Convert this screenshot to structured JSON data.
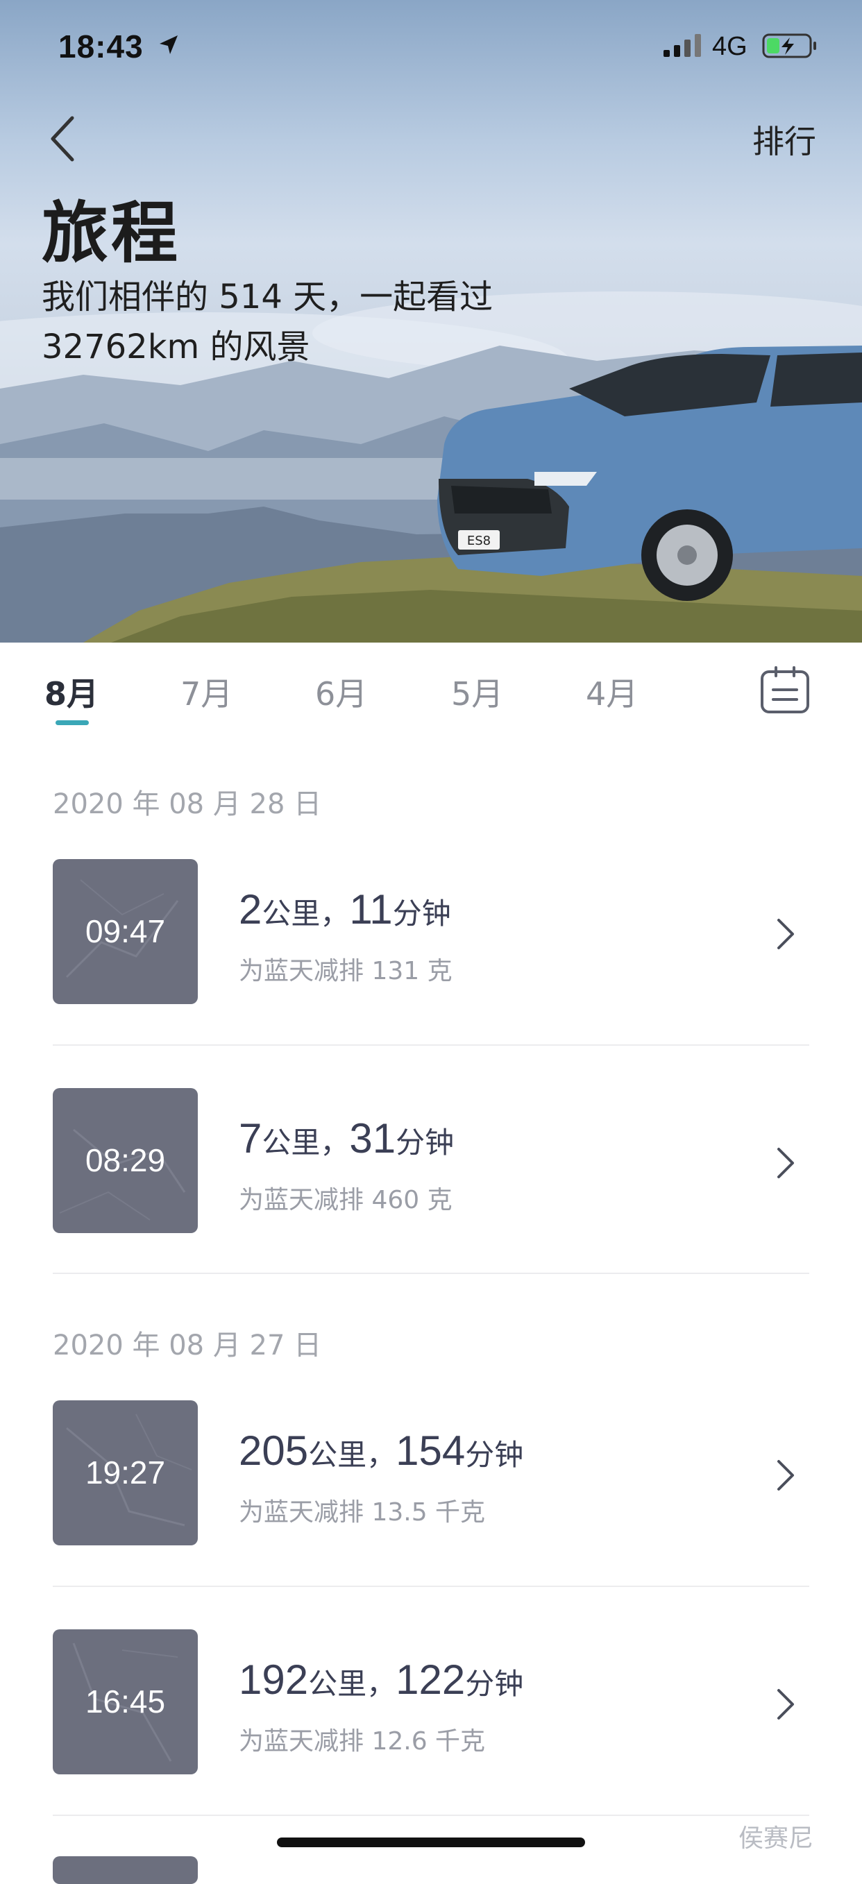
{
  "status": {
    "time": "18:43",
    "network": "4G"
  },
  "header": {
    "rank_label": "排行",
    "title": "旅程",
    "subtitle_line1": "我们相伴的 514 天，一起看过",
    "subtitle_line2": "32762km 的风景"
  },
  "tabs": [
    {
      "label": "8月",
      "active": true
    },
    {
      "label": "7月",
      "active": false
    },
    {
      "label": "6月",
      "active": false
    },
    {
      "label": "5月",
      "active": false
    },
    {
      "label": "4月",
      "active": false
    }
  ],
  "days": [
    {
      "date": "2020 年 08 月 28 日",
      "trips": [
        {
          "time": "09:47",
          "distance": "2",
          "distance_unit": "公里，",
          "duration": "11",
          "duration_unit": "分钟",
          "emission": "为蓝天减排 131 克"
        },
        {
          "time": "08:29",
          "distance": "7",
          "distance_unit": "公里，",
          "duration": "31",
          "duration_unit": "分钟",
          "emission": "为蓝天减排 460 克"
        }
      ]
    },
    {
      "date": "2020 年 08 月 27 日",
      "trips": [
        {
          "time": "19:27",
          "distance": "205",
          "distance_unit": "公里，",
          "duration": "154",
          "duration_unit": "分钟",
          "emission": "为蓝天减排 13.5 千克"
        },
        {
          "time": "16:45",
          "distance": "192",
          "distance_unit": "公里，",
          "duration": "122",
          "duration_unit": "分钟",
          "emission": "为蓝天减排 12.6 千克"
        }
      ]
    }
  ],
  "car_badge": "ES8",
  "watermark": "侯赛尼",
  "colors": {
    "accent": "#3aa7b7",
    "thumb_bg": "#6c6f7e",
    "muted_text": "#9a9da6"
  }
}
